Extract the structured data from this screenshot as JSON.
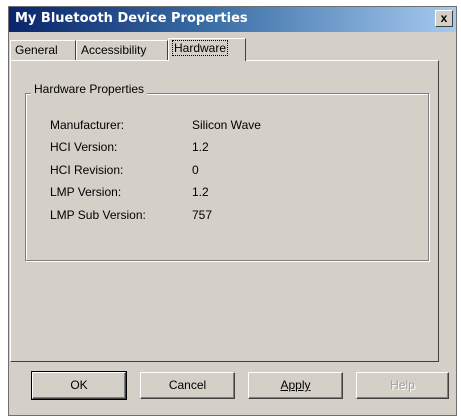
{
  "window": {
    "title": "My Bluetooth Device Properties",
    "close_label": "x"
  },
  "tabs": [
    {
      "label": "General",
      "selected": false
    },
    {
      "label": "Accessibility",
      "selected": false
    },
    {
      "label": "Hardware",
      "selected": true
    }
  ],
  "hardware": {
    "group_title": "Hardware Properties",
    "properties": [
      {
        "label": "Manufacturer:",
        "value": "Silicon Wave"
      },
      {
        "label": "HCI Version:",
        "value": "1.2"
      },
      {
        "label": "HCI Revision:",
        "value": "0"
      },
      {
        "label": "LMP Version:",
        "value": "1.2"
      },
      {
        "label": "LMP Sub Version:",
        "value": "757"
      }
    ]
  },
  "buttons": {
    "ok": "OK",
    "cancel": "Cancel",
    "apply": "Apply",
    "help": "Help"
  }
}
